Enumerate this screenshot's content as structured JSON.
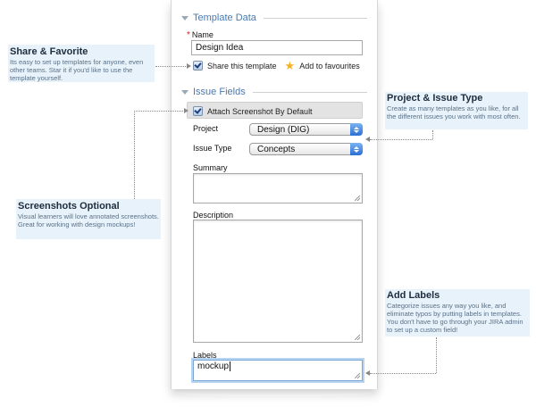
{
  "form": {
    "template_section": "Template Data",
    "name_label": "Name",
    "name_value": "Design Idea",
    "share_label": "Share this template",
    "favourite_label": "Add to favourites",
    "issue_section": "Issue Fields",
    "attach_label": "Attach Screenshot By Default",
    "project_label": "Project",
    "project_value": "Design (DIG)",
    "issue_type_label": "Issue Type",
    "issue_type_value": "Concepts",
    "summary_label": "Summary",
    "description_label": "Description",
    "labels_label": "Labels",
    "labels_value": "mockup"
  },
  "callouts": {
    "share": {
      "title": "Share & Favorite",
      "text": "Its easy to set up templates for anyone, even other teams. Star it if you'd like to use the template yourself."
    },
    "project": {
      "title": "Project & Issue Type",
      "text": "Create as many templates as you like, for all the different issues you work with most often."
    },
    "screenshots": {
      "title": "Screenshots Optional",
      "text": "Visual learners will love annotated screenshots. Great for working with design mockups!"
    },
    "labels": {
      "title": "Add Labels",
      "text": "Categorize issues any way you like, and eliminate typos by putting labels in templates. You don't have to go through your JIRA admin to set up a custom field!"
    }
  },
  "colors": {
    "accent": "#4a7ab0",
    "callout_bg": "#e8f2fb",
    "select_arrow": "#2b6fd4"
  }
}
